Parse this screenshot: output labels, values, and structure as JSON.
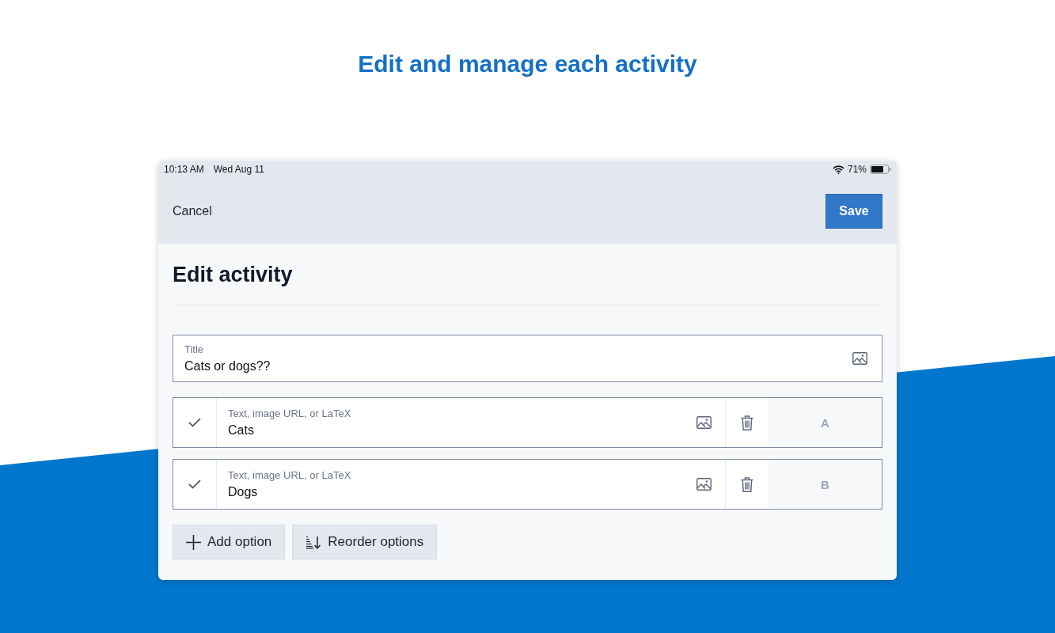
{
  "headline": "Edit and manage each activity",
  "status_bar": {
    "time": "10:13 AM",
    "date": "Wed Aug 11",
    "battery": "71%"
  },
  "nav_bar": {
    "cancel": "Cancel",
    "save": "Save"
  },
  "page_title": "Edit activity",
  "title_field": {
    "label": "Title",
    "value": "Cats or dogs??"
  },
  "options": [
    {
      "label": "Text, image URL, or LaTeX",
      "value": "Cats",
      "letter": "A"
    },
    {
      "label": "Text, image URL, or LaTeX",
      "value": "Dogs",
      "letter": "B"
    }
  ],
  "buttons": [
    {
      "kind": "add",
      "label": "Add option"
    },
    {
      "kind": "reorder",
      "label": "Reorder options"
    }
  ]
}
